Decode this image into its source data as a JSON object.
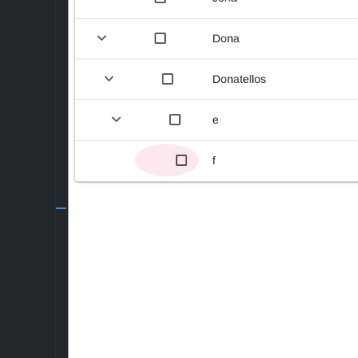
{
  "tree": {
    "rows": [
      {
        "label": "Jona",
        "has_toggle": false,
        "checked": false
      },
      {
        "label": "Dona",
        "has_toggle": true,
        "checked": false
      },
      {
        "label": "Donatellos",
        "has_toggle": true,
        "checked": false
      },
      {
        "label": "e",
        "has_toggle": true,
        "checked": false
      },
      {
        "label": "f",
        "has_toggle": false,
        "checked": false,
        "focused": true
      }
    ]
  },
  "colors": {
    "sidebar_bg": "#22272b",
    "sidebar_marker": "#3d8fd6",
    "focus_ripple": "#fce4ec",
    "checkbox_border": "#5f5f5f"
  },
  "icons": {
    "expand": "chevron-down-icon"
  }
}
